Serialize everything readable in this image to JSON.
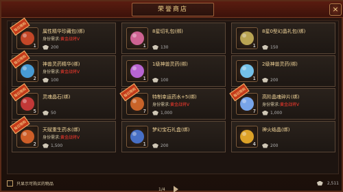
{
  "window": {
    "title": "荣誉商店",
    "close_label": "×"
  },
  "shop": {
    "items": [
      {
        "name": "属性精华珍藏包(绑)",
        "has_badge": true,
        "badge_label": "每日限购",
        "requirement_label": "身份需求:",
        "requirement_value": "黄金战将Ⅴ",
        "quantity": "1",
        "price": "200",
        "icon_name": "treasure-pack-icon",
        "icon_color": "#d44b2a"
      },
      {
        "name": "8星切礼包(绑)",
        "has_badge": false,
        "badge_label": "",
        "requirement_label": "",
        "requirement_value": "",
        "quantity": "1",
        "price": "130",
        "icon_name": "gift-box-icon",
        "icon_color": "#e06aa0"
      },
      {
        "name": "8星0型幻晶礼包(绑)",
        "has_badge": false,
        "badge_label": "",
        "requirement_label": "",
        "requirement_value": "",
        "quantity": "1",
        "price": "150",
        "icon_name": "gift-box-icon",
        "icon_color": "#c9b25a"
      },
      {
        "name": "神兽灵药精华(绑)",
        "has_badge": true,
        "badge_label": "每日限购",
        "requirement_label": "身份需求:",
        "requirement_value": "黄金战将Ⅴ",
        "quantity": "2",
        "price": "100",
        "icon_name": "potion-orb-icon",
        "icon_color": "#4aa7e8"
      },
      {
        "name": "1级神兽灵药(绑)",
        "has_badge": false,
        "badge_label": "",
        "requirement_label": "",
        "requirement_value": "",
        "quantity": "1",
        "price": "100",
        "icon_name": "potion-orb-icon",
        "icon_color": "#c66be6"
      },
      {
        "name": "2级神兽灵药(绑)",
        "has_badge": false,
        "badge_label": "",
        "requirement_label": "",
        "requirement_value": "",
        "quantity": "1",
        "price": "200",
        "icon_name": "potion-orb-icon",
        "icon_color": "#7bd1ff"
      },
      {
        "name": "灵魂晶石(绑)",
        "has_badge": true,
        "badge_label": "每日限购",
        "requirement_label": "",
        "requirement_value": "",
        "quantity": "5",
        "price": "50",
        "icon_name": "crystal-icon",
        "icon_color": "#d23b3b"
      },
      {
        "name": "特制幸运药水+5(绑)",
        "has_badge": true,
        "badge_label": "每日限购",
        "requirement_label": "身份需求:",
        "requirement_value": "黄金战将Ⅴ",
        "quantity": "7",
        "price": "1,000",
        "icon_name": "potion-bottle-icon",
        "icon_color": "#d86a2b"
      },
      {
        "name": "高阶晶魂碎片(绑)",
        "has_badge": true,
        "badge_label": "每日限购",
        "requirement_label": "身份需求:",
        "requirement_value": "黄金战将Ⅴ",
        "quantity": "7",
        "price": "1,000",
        "icon_name": "shard-icon",
        "icon_color": "#7fb3ff"
      },
      {
        "name": "天赋重生药水(绑)",
        "has_badge": true,
        "badge_label": "每日限购",
        "requirement_label": "身份需求:",
        "requirement_value": "黄金战将Ⅴ",
        "quantity": "2",
        "price": "1,500",
        "icon_name": "elixir-icon",
        "icon_color": "#e0652a"
      },
      {
        "name": "梦幻宝石礼盒(绑)",
        "has_badge": false,
        "badge_label": "",
        "requirement_label": "",
        "requirement_value": "",
        "quantity": "1",
        "price": "200",
        "icon_name": "chest-icon",
        "icon_color": "#4a78d8"
      },
      {
        "name": "神火结晶(绑)",
        "has_badge": false,
        "badge_label": "",
        "requirement_label": "",
        "requirement_value": "",
        "quantity": "4",
        "price": "200",
        "icon_name": "flame-crystal-icon",
        "icon_color": "#f0b02a"
      }
    ]
  },
  "pagination": {
    "page_text": "1/4"
  },
  "footer": {
    "filter_label": "只显示可购买的物品",
    "currency_value": "2,511"
  }
}
